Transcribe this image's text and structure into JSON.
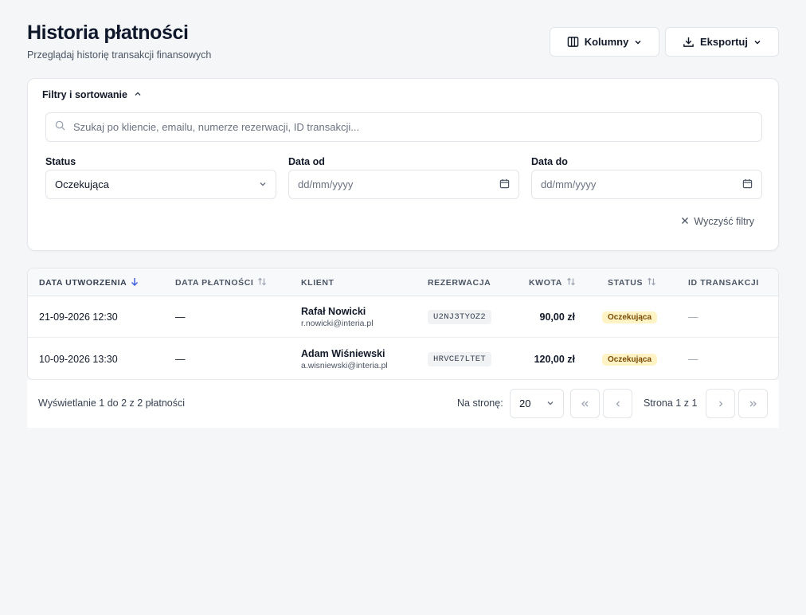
{
  "header": {
    "title": "Historia płatności",
    "subtitle": "Przeglądaj historię transakcji finansowych",
    "columns_label": "Kolumny",
    "export_label": "Eksportuj"
  },
  "filters": {
    "title": "Filtry i sortowanie",
    "search_placeholder": "Szukaj po kliencie, emailu, numerze rezerwacji, ID transakcji...",
    "status_label": "Status",
    "status_value": "Oczekująca",
    "date_from_label": "Data od",
    "date_from_placeholder": "dd/mm/yyyy",
    "date_to_label": "Data do",
    "date_to_placeholder": "dd/mm/yyyy",
    "clear_label": "Wyczyść filtry"
  },
  "table": {
    "columns": [
      "DATA UTWORZENIA",
      "DATA PŁATNOŚCI",
      "KLIENT",
      "REZERWACJA",
      "KWOTA",
      "STATUS",
      "ID TRANSAKCJI"
    ],
    "rows": [
      {
        "created": "21-09-2026 12:30",
        "paid": "—",
        "client_name": "Rafał Nowicki",
        "client_email": "r.nowicki@interia.pl",
        "reservation": "U2NJ3TYOZ2",
        "amount": "90,00 zł",
        "status": "Oczekująca",
        "transaction_id": "—"
      },
      {
        "created": "10-09-2026 13:30",
        "paid": "—",
        "client_name": "Adam Wiśniewski",
        "client_email": "a.wisniewski@interia.pl",
        "reservation": "HRVCE7LTET",
        "amount": "120,00 zł",
        "status": "Oczekująca",
        "transaction_id": "—"
      }
    ]
  },
  "pagination": {
    "info": "Wyświetlanie 1 do 2 z 2 płatności",
    "per_page_label": "Na stronę:",
    "per_page_value": "20",
    "page_text": "Strona 1 z 1"
  },
  "colors": {
    "accent": "#3b5bdb",
    "badge_bg": "#fdf3c4",
    "badge_text": "#7a4b06"
  }
}
